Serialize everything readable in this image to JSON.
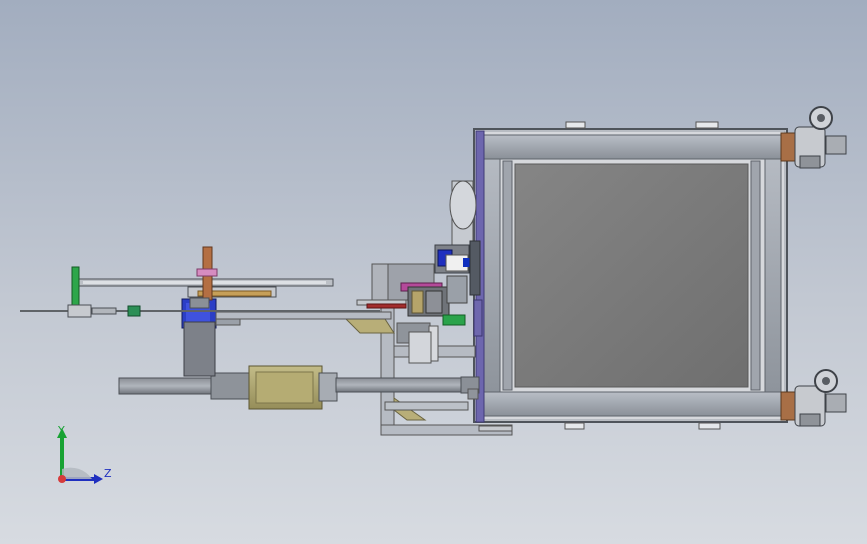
{
  "triad": {
    "x_label": "",
    "y_label": "Y",
    "z_label": "Z"
  },
  "colors": {
    "background_top": "#a2adbf",
    "background_bottom": "#d7dbe1",
    "frame_gray": "#9ea3aa",
    "frame_dark": "#5f646b",
    "panel_gray": "#7f7f7f",
    "purple_plate": "#6861a8",
    "tan_part": "#b4ad77",
    "blue_part": "#1e35c7",
    "green_part": "#27a64a",
    "orange_part": "#b56d43",
    "pink_part": "#d27db2",
    "red_part": "#a52e2e"
  }
}
